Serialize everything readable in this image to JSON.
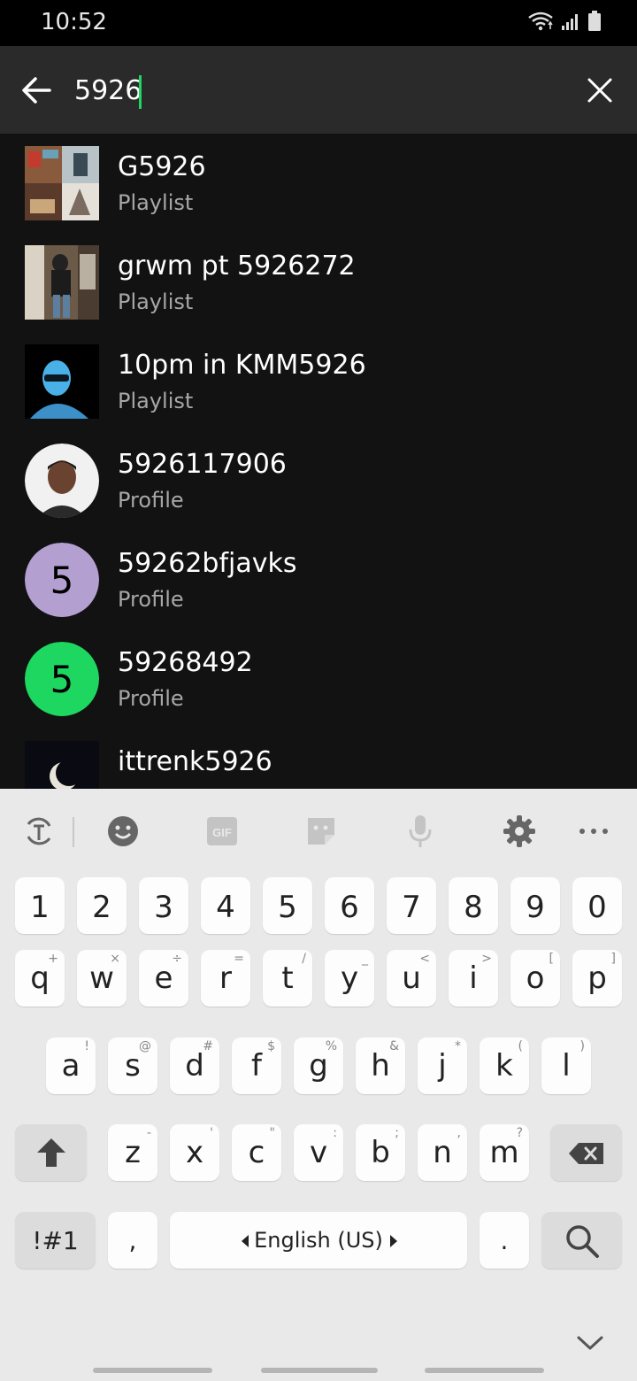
{
  "status_bar": {
    "time": "10:52",
    "icons": [
      "wifi-icon",
      "signal-icon",
      "battery-icon"
    ]
  },
  "search": {
    "value": "5926",
    "placeholder": ""
  },
  "results": [
    {
      "title": "G5926",
      "subtitle": "Playlist",
      "kind": "playlist"
    },
    {
      "title": "grwm pt 5926272",
      "subtitle": "Playlist",
      "kind": "playlist"
    },
    {
      "title": "10pm in KMM5926",
      "subtitle": "Playlist",
      "kind": "playlist"
    },
    {
      "title": "5926117906",
      "subtitle": "Profile",
      "kind": "profile"
    },
    {
      "title": "59262bfjavks",
      "subtitle": "Profile",
      "kind": "profile",
      "initial": "5",
      "color": "#b3a0d0"
    },
    {
      "title": "59268492",
      "subtitle": "Profile",
      "kind": "profile",
      "initial": "5",
      "color": "#1ed760"
    },
    {
      "title": "ittrenk5926",
      "subtitle": "",
      "kind": "playlist"
    }
  ],
  "keyboard": {
    "toolbar": [
      "text-style-icon",
      "emoji-icon",
      "gif-icon",
      "sticker-icon",
      "mic-icon",
      "settings-icon",
      "more-icon"
    ],
    "gif_label": "GIF",
    "number_row": [
      "1",
      "2",
      "3",
      "4",
      "5",
      "6",
      "7",
      "8",
      "9",
      "0"
    ],
    "row1": {
      "keys": [
        "q",
        "w",
        "e",
        "r",
        "t",
        "y",
        "u",
        "i",
        "o",
        "p"
      ],
      "hints": [
        "+",
        "×",
        "÷",
        "=",
        "/",
        "_",
        "<",
        ">",
        "[",
        "]"
      ]
    },
    "row2": {
      "keys": [
        "a",
        "s",
        "d",
        "f",
        "g",
        "h",
        "j",
        "k",
        "l"
      ],
      "hints": [
        "!",
        "@",
        "#",
        "$",
        "%",
        "&",
        "*",
        "(",
        ")"
      ]
    },
    "row3": {
      "keys": [
        "z",
        "x",
        "c",
        "v",
        "b",
        "n",
        "m"
      ],
      "hints": [
        "-",
        "'",
        "\"",
        ":",
        ";",
        ",",
        "?"
      ]
    },
    "symbols_label": "!#1",
    "comma_label": ",",
    "space_label": "English (US)",
    "period_label": ".",
    "colors": {
      "background": "#e9e9e9",
      "key": "#fdfdfd",
      "function_key": "#dcdcdc"
    }
  },
  "colors": {
    "accent": "#1ed760",
    "background": "#121212",
    "header": "#2a2a2a",
    "subtitle": "#a7a7a7"
  }
}
